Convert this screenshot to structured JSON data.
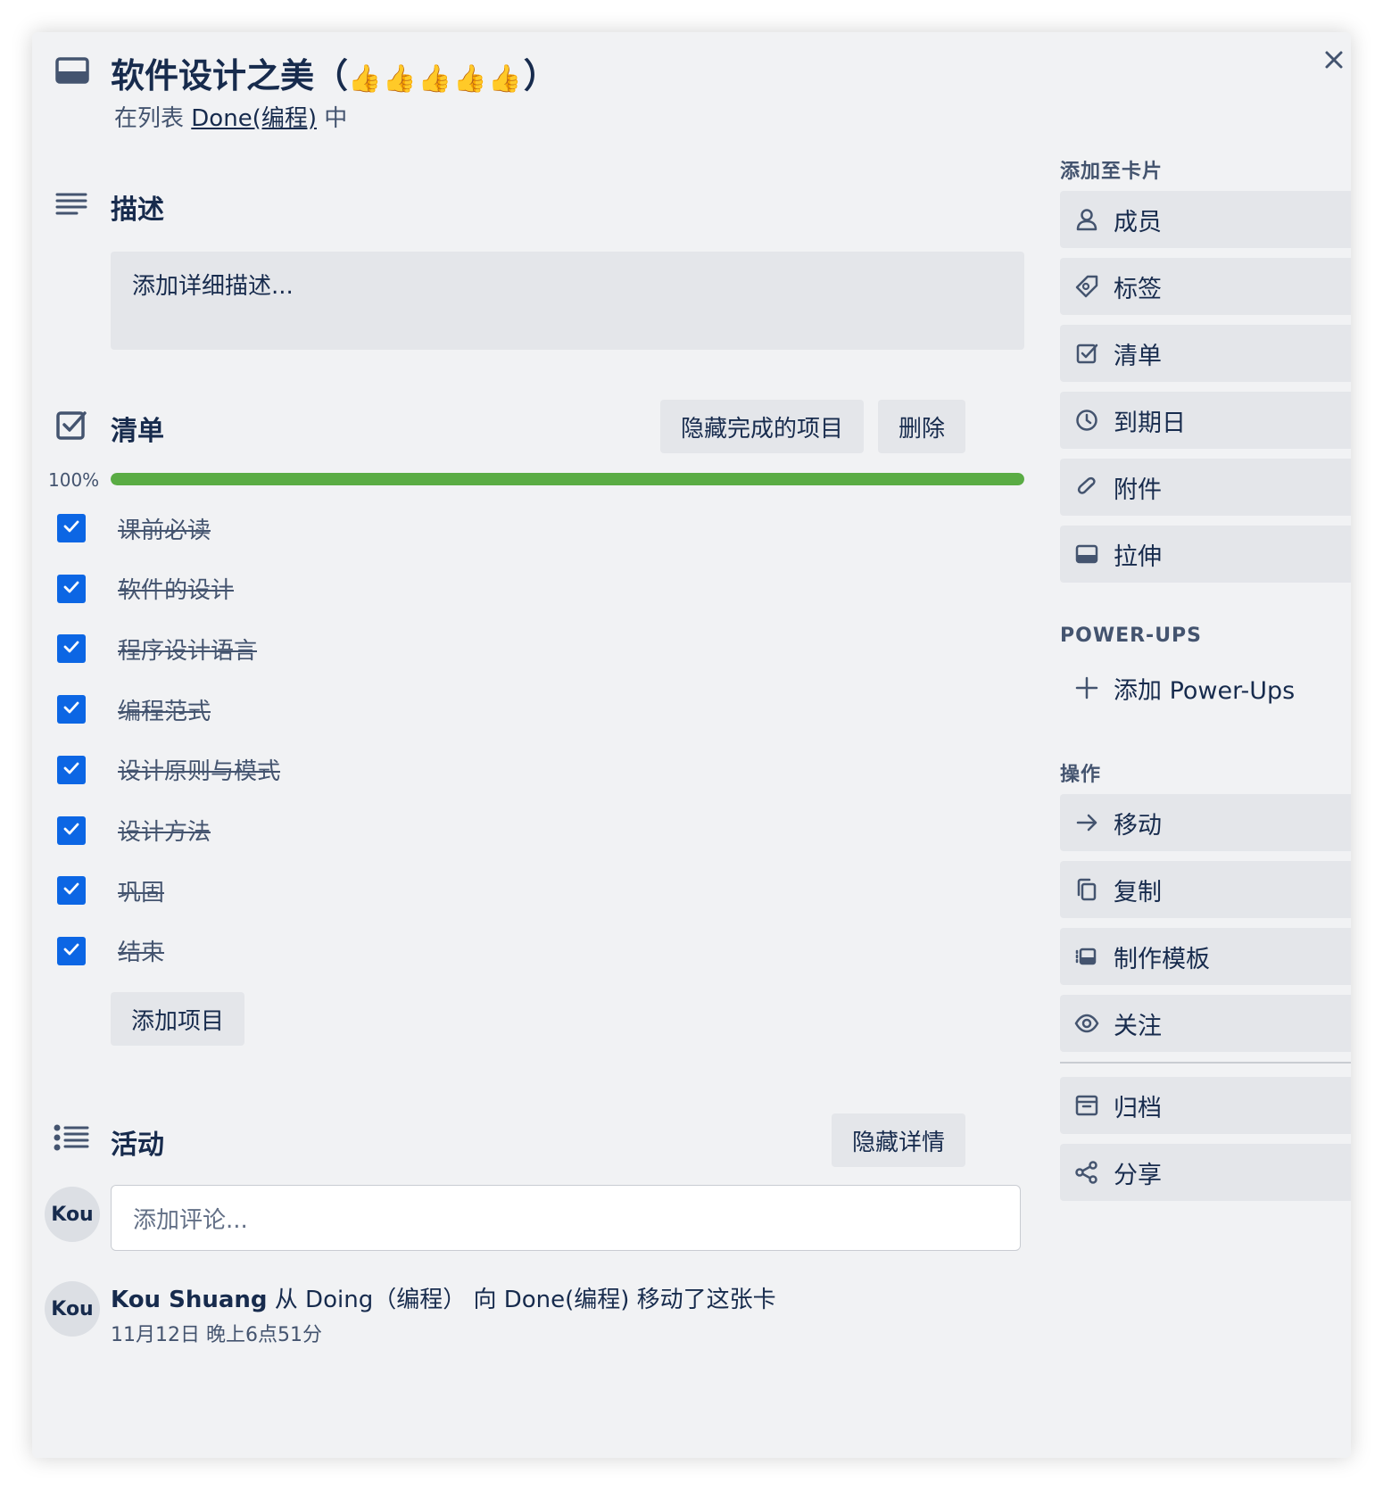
{
  "header": {
    "title": "软件设计之美（",
    "thumbs": "👍👍👍👍👍",
    "title_close": "）",
    "list_prefix": "在列表",
    "list_name": "Done(编程)",
    "list_suffix": "中"
  },
  "description": {
    "heading": "描述",
    "placeholder": "添加详细描述..."
  },
  "checklist": {
    "heading": "清单",
    "hide_completed_label": "隐藏完成的项目",
    "delete_label": "删除",
    "progress_percent": "100%",
    "progress_value": 1.0,
    "items": [
      {
        "label": "课前必读",
        "checked": true
      },
      {
        "label": "软件的设计",
        "checked": true
      },
      {
        "label": "程序设计语言",
        "checked": true
      },
      {
        "label": "编程范式",
        "checked": true
      },
      {
        "label": "设计原则与模式",
        "checked": true
      },
      {
        "label": "设计方法",
        "checked": true
      },
      {
        "label": "巩固",
        "checked": true
      },
      {
        "label": "结束",
        "checked": true
      }
    ],
    "add_item_label": "添加项目"
  },
  "activity": {
    "heading": "活动",
    "hide_details_label": "隐藏详情",
    "comment_placeholder": "添加评论...",
    "avatar_initials": "Kou",
    "entries": [
      {
        "user": "Kou Shuang",
        "text": "从 Doing（编程） 向 Done(编程) 移动了这张卡",
        "time": "11月12日 晚上6点51分",
        "avatar": "Kou"
      }
    ]
  },
  "sidebar": {
    "add_to_card_heading": "添加至卡片",
    "add_to_card": [
      {
        "label": "成员",
        "icon": "person-icon"
      },
      {
        "label": "标签",
        "icon": "tag-icon"
      },
      {
        "label": "清单",
        "icon": "checklist-icon"
      },
      {
        "label": "到期日",
        "icon": "clock-icon"
      },
      {
        "label": "附件",
        "icon": "paperclip-icon"
      },
      {
        "label": "拉伸",
        "icon": "cover-icon"
      }
    ],
    "powerups_heading": "POWER-UPS",
    "add_powerups_label": "添加 Power-Ups",
    "actions_heading": "操作",
    "actions": [
      {
        "label": "移动",
        "icon": "arrow-right-icon"
      },
      {
        "label": "复制",
        "icon": "copy-icon"
      },
      {
        "label": "制作模板",
        "icon": "template-icon"
      },
      {
        "label": "关注",
        "icon": "eye-icon"
      }
    ],
    "actions_secondary": [
      {
        "label": "归档",
        "icon": "archive-icon"
      },
      {
        "label": "分享",
        "icon": "share-icon"
      }
    ]
  },
  "colors": {
    "accent": "#0c66e4",
    "progress": "#5aac44",
    "background": "#f1f2f4",
    "button": "#e4e6ea",
    "text": "#172b4d"
  }
}
